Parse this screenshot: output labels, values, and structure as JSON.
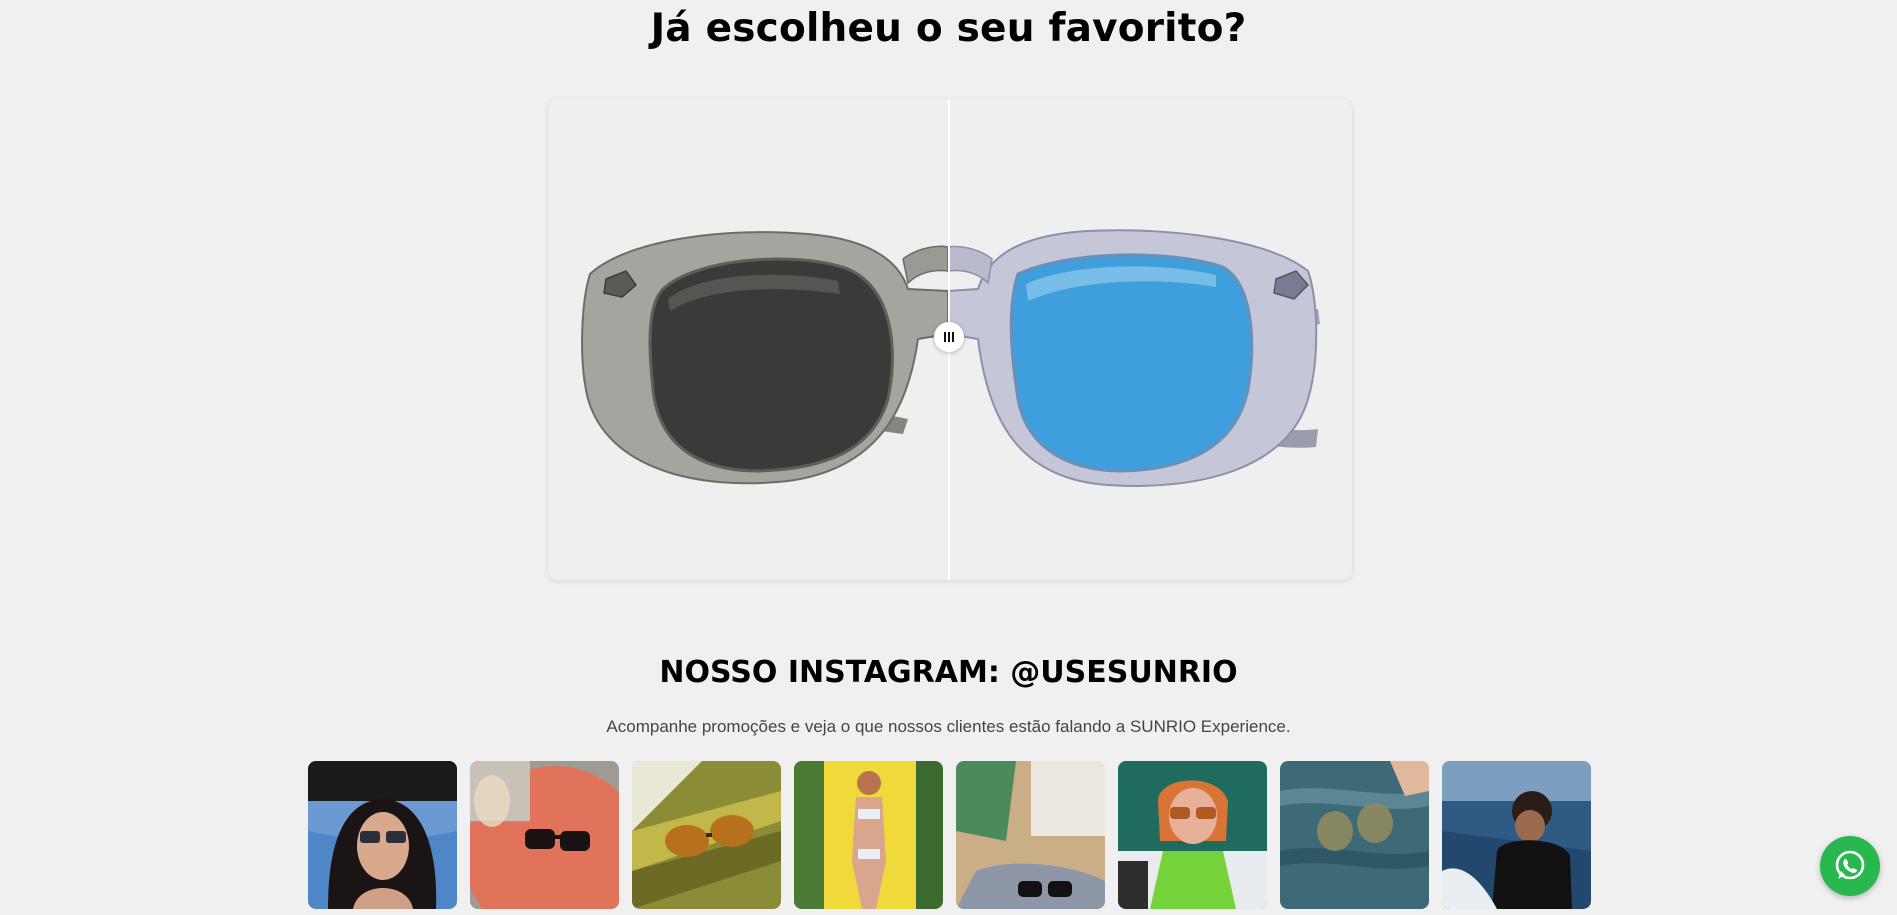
{
  "headline": "Já escolheu o seu favorito?",
  "compare": {
    "left_image": "sunglasses-smoke-lens",
    "right_image": "sunglasses-blue-lens",
    "handle_icon": "drag-handle-icon",
    "position_fraction": 0.5
  },
  "instagram": {
    "title": "NOSSO INSTAGRAM: @USESUNRIO",
    "subtitle": "Acompanhe promoções e veja o que nossos clientes estão falando a SUNRIO Experience.",
    "posts": [
      "instagram-post-1",
      "instagram-post-2",
      "instagram-post-3",
      "instagram-post-4",
      "instagram-post-5",
      "instagram-post-6",
      "instagram-post-7",
      "instagram-post-8"
    ]
  },
  "whatsapp": {
    "icon": "whatsapp-icon",
    "color": "#29b84f"
  },
  "colors": {
    "background": "#f0f0f0",
    "blue_lens": "#3f9fdc",
    "smoke_lens": "#3a3a38"
  }
}
